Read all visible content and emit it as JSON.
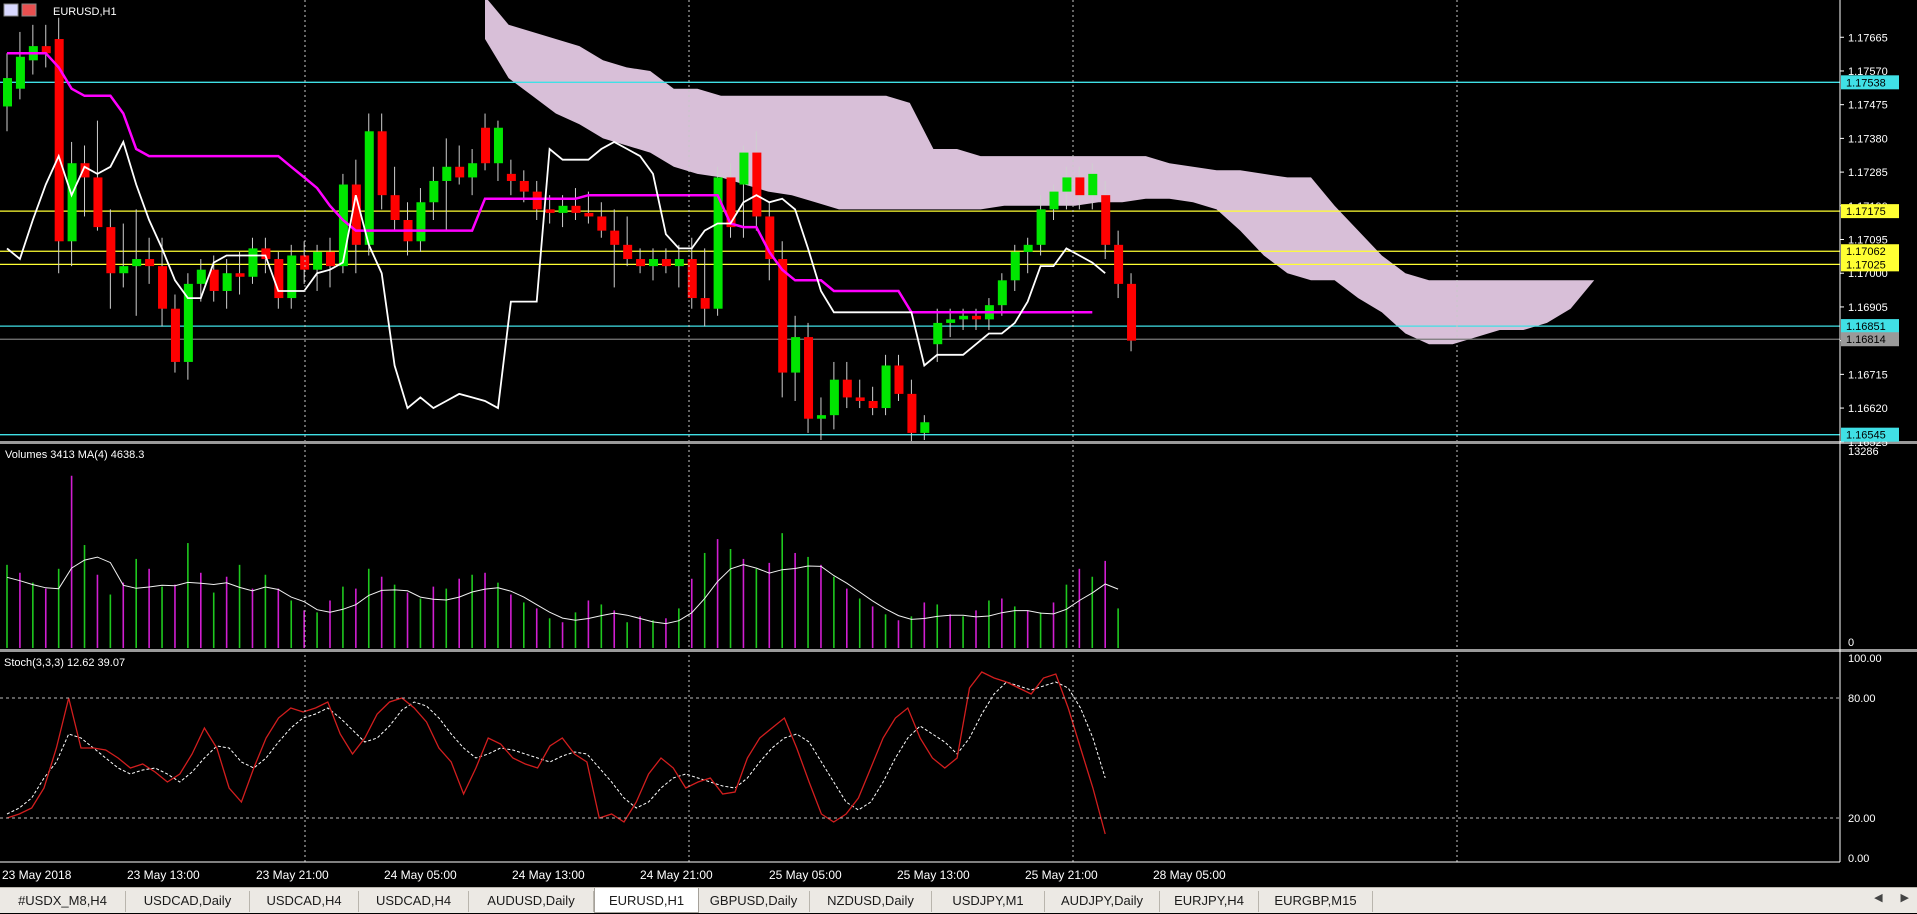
{
  "window": {
    "symbol_label": "EURUSD,H1"
  },
  "colors": {
    "background": "#000000",
    "grid": "#c8c8c8",
    "axis_text": "#ffffff",
    "bull": "#00e600",
    "bear": "#ff0000",
    "cloud": "#d8bfd8",
    "tenkan": "#ff00ff",
    "kijun": "#ffffff",
    "cyan_line": "#40e0e6",
    "yellow_line": "#ffff33",
    "volume_up": "#1ec81e",
    "volume_down": "#d21ed2",
    "stoch_main": "#d21e1e",
    "stoch_signal": "#ffffff"
  },
  "chart_data": [
    {
      "type": "candlestick",
      "title": "EURUSD,H1",
      "price_axis_ticks": [
        "1.17665",
        "1.17570",
        "1.17475",
        "1.17380",
        "1.17285",
        "1.17190",
        "1.17095",
        "1.17000",
        "1.16905",
        "1.16810",
        "1.16715",
        "1.16620",
        "1.16525"
      ],
      "ylim": [
        1.1653,
        1.1777
      ],
      "horizontal_levels": [
        {
          "label": "1.17538",
          "value": 1.17538,
          "color": "cyan"
        },
        {
          "label": "1.17175",
          "value": 1.17175,
          "color": "yellow"
        },
        {
          "label": "1.17062",
          "value": 1.17062,
          "color": "yellow"
        },
        {
          "label": "1.17025",
          "value": 1.17025,
          "color": "yellow"
        },
        {
          "label": "1.16851",
          "value": 1.16851,
          "color": "cyan"
        },
        {
          "label": "1.16814",
          "value": 1.16814,
          "color": "gray"
        },
        {
          "label": "1.16545",
          "value": 1.16545,
          "color": "cyan"
        }
      ],
      "time_labels": [
        "23 May 2018",
        "23 May 13:00",
        "23 May 21:00",
        "24 May 05:00",
        "24 May 13:00",
        "24 May 21:00",
        "25 May 05:00",
        "25 May 13:00",
        "25 May 21:00",
        "28 May 05:00"
      ],
      "candles": [
        {
          "o": 1.1747,
          "h": 1.1762,
          "l": 1.174,
          "c": 1.1755
        },
        {
          "o": 1.1752,
          "h": 1.1768,
          "l": 1.1749,
          "c": 1.1761
        },
        {
          "o": 1.176,
          "h": 1.177,
          "l": 1.1756,
          "c": 1.1764
        },
        {
          "o": 1.1764,
          "h": 1.177,
          "l": 1.1758,
          "c": 1.1762
        },
        {
          "o": 1.1766,
          "h": 1.1772,
          "l": 1.17,
          "c": 1.1709
        },
        {
          "o": 1.1709,
          "h": 1.1737,
          "l": 1.1702,
          "c": 1.1731
        },
        {
          "o": 1.1731,
          "h": 1.1736,
          "l": 1.1716,
          "c": 1.1727
        },
        {
          "o": 1.1727,
          "h": 1.1743,
          "l": 1.1712,
          "c": 1.1713
        },
        {
          "o": 1.1713,
          "h": 1.1718,
          "l": 1.169,
          "c": 1.17
        },
        {
          "o": 1.17,
          "h": 1.1714,
          "l": 1.1696,
          "c": 1.1702
        },
        {
          "o": 1.1702,
          "h": 1.1718,
          "l": 1.1688,
          "c": 1.1704
        },
        {
          "o": 1.1704,
          "h": 1.171,
          "l": 1.1697,
          "c": 1.1702
        },
        {
          "o": 1.1702,
          "h": 1.171,
          "l": 1.1685,
          "c": 1.169
        },
        {
          "o": 1.169,
          "h": 1.1694,
          "l": 1.1672,
          "c": 1.1675
        },
        {
          "o": 1.1675,
          "h": 1.17,
          "l": 1.167,
          "c": 1.1697
        },
        {
          "o": 1.1697,
          "h": 1.1704,
          "l": 1.1692,
          "c": 1.1701
        },
        {
          "o": 1.1701,
          "h": 1.1705,
          "l": 1.1692,
          "c": 1.1695
        },
        {
          "o": 1.1695,
          "h": 1.1704,
          "l": 1.169,
          "c": 1.17
        },
        {
          "o": 1.17,
          "h": 1.1706,
          "l": 1.1694,
          "c": 1.1699
        },
        {
          "o": 1.1699,
          "h": 1.171,
          "l": 1.1697,
          "c": 1.1707
        },
        {
          "o": 1.1707,
          "h": 1.171,
          "l": 1.17,
          "c": 1.1704
        },
        {
          "o": 1.1704,
          "h": 1.1706,
          "l": 1.169,
          "c": 1.1693
        },
        {
          "o": 1.1693,
          "h": 1.1708,
          "l": 1.169,
          "c": 1.1705
        },
        {
          "o": 1.1705,
          "h": 1.1709,
          "l": 1.1697,
          "c": 1.1701
        },
        {
          "o": 1.1701,
          "h": 1.1708,
          "l": 1.1695,
          "c": 1.1706
        },
        {
          "o": 1.1706,
          "h": 1.171,
          "l": 1.1696,
          "c": 1.1702
        },
        {
          "o": 1.1702,
          "h": 1.1728,
          "l": 1.17,
          "c": 1.1725
        },
        {
          "o": 1.1725,
          "h": 1.1732,
          "l": 1.17,
          "c": 1.1708
        },
        {
          "o": 1.1708,
          "h": 1.1745,
          "l": 1.1705,
          "c": 1.174
        },
        {
          "o": 1.174,
          "h": 1.1745,
          "l": 1.1718,
          "c": 1.1722
        },
        {
          "o": 1.1722,
          "h": 1.173,
          "l": 1.1712,
          "c": 1.1715
        },
        {
          "o": 1.1715,
          "h": 1.172,
          "l": 1.1705,
          "c": 1.1709
        },
        {
          "o": 1.1709,
          "h": 1.1724,
          "l": 1.1706,
          "c": 1.172
        },
        {
          "o": 1.172,
          "h": 1.173,
          "l": 1.1715,
          "c": 1.1726
        },
        {
          "o": 1.1726,
          "h": 1.1738,
          "l": 1.1712,
          "c": 1.173
        },
        {
          "o": 1.173,
          "h": 1.1736,
          "l": 1.1725,
          "c": 1.1727
        },
        {
          "o": 1.1727,
          "h": 1.1735,
          "l": 1.1722,
          "c": 1.1731
        },
        {
          "o": 1.1741,
          "h": 1.1745,
          "l": 1.1729,
          "c": 1.1731
        },
        {
          "o": 1.1731,
          "h": 1.1743,
          "l": 1.1726,
          "c": 1.1741
        },
        {
          "o": 1.1728,
          "h": 1.1732,
          "l": 1.1722,
          "c": 1.1726
        },
        {
          "o": 1.1726,
          "h": 1.1729,
          "l": 1.172,
          "c": 1.1723
        },
        {
          "o": 1.1723,
          "h": 1.1726,
          "l": 1.1715,
          "c": 1.1718
        },
        {
          "o": 1.1718,
          "h": 1.1722,
          "l": 1.1714,
          "c": 1.1717
        },
        {
          "o": 1.1717,
          "h": 1.1722,
          "l": 1.1713,
          "c": 1.1719
        },
        {
          "o": 1.1719,
          "h": 1.1724,
          "l": 1.1715,
          "c": 1.1717
        },
        {
          "o": 1.1717,
          "h": 1.1723,
          "l": 1.1714,
          "c": 1.1716
        },
        {
          "o": 1.1716,
          "h": 1.172,
          "l": 1.171,
          "c": 1.1712
        },
        {
          "o": 1.1712,
          "h": 1.1718,
          "l": 1.1696,
          "c": 1.1708
        },
        {
          "o": 1.1708,
          "h": 1.1716,
          "l": 1.1702,
          "c": 1.1704
        },
        {
          "o": 1.1704,
          "h": 1.1707,
          "l": 1.17,
          "c": 1.1702
        },
        {
          "o": 1.1702,
          "h": 1.1707,
          "l": 1.1698,
          "c": 1.1704
        },
        {
          "o": 1.1704,
          "h": 1.1707,
          "l": 1.17,
          "c": 1.1702
        },
        {
          "o": 1.1702,
          "h": 1.1708,
          "l": 1.1696,
          "c": 1.1704
        },
        {
          "o": 1.1704,
          "h": 1.171,
          "l": 1.169,
          "c": 1.1693
        },
        {
          "o": 1.1693,
          "h": 1.1707,
          "l": 1.1685,
          "c": 1.169
        },
        {
          "o": 1.169,
          "h": 1.173,
          "l": 1.1688,
          "c": 1.1727
        },
        {
          "o": 1.1727,
          "h": 1.1731,
          "l": 1.171,
          "c": 1.1713
        },
        {
          "o": 1.1725,
          "h": 1.1736,
          "l": 1.171,
          "c": 1.1734
        },
        {
          "o": 1.1734,
          "h": 1.174,
          "l": 1.1712,
          "c": 1.1716
        },
        {
          "o": 1.1716,
          "h": 1.172,
          "l": 1.1698,
          "c": 1.1704
        },
        {
          "o": 1.1704,
          "h": 1.1709,
          "l": 1.1665,
          "c": 1.1672
        },
        {
          "o": 1.1672,
          "h": 1.1688,
          "l": 1.1664,
          "c": 1.1682
        },
        {
          "o": 1.1682,
          "h": 1.1686,
          "l": 1.1655,
          "c": 1.1659
        },
        {
          "o": 1.1659,
          "h": 1.1665,
          "l": 1.1653,
          "c": 1.166
        },
        {
          "o": 1.166,
          "h": 1.1675,
          "l": 1.1656,
          "c": 1.167
        },
        {
          "o": 1.167,
          "h": 1.1675,
          "l": 1.1662,
          "c": 1.1665
        },
        {
          "o": 1.1665,
          "h": 1.167,
          "l": 1.1662,
          "c": 1.1664
        },
        {
          "o": 1.1664,
          "h": 1.1668,
          "l": 1.166,
          "c": 1.1662
        },
        {
          "o": 1.1662,
          "h": 1.1677,
          "l": 1.166,
          "c": 1.1674
        },
        {
          "o": 1.1674,
          "h": 1.1677,
          "l": 1.1664,
          "c": 1.1666
        },
        {
          "o": 1.1666,
          "h": 1.167,
          "l": 1.1652,
          "c": 1.1655
        },
        {
          "o": 1.1655,
          "h": 1.166,
          "l": 1.1653,
          "c": 1.1658
        },
        {
          "o": 1.168,
          "h": 1.169,
          "l": 1.1675,
          "c": 1.1686
        },
        {
          "o": 1.1686,
          "h": 1.169,
          "l": 1.1682,
          "c": 1.1687
        },
        {
          "o": 1.1687,
          "h": 1.169,
          "l": 1.1684,
          "c": 1.1688
        },
        {
          "o": 1.1688,
          "h": 1.169,
          "l": 1.1684,
          "c": 1.1687
        },
        {
          "o": 1.1687,
          "h": 1.1693,
          "l": 1.1684,
          "c": 1.1691
        },
        {
          "o": 1.1691,
          "h": 1.17,
          "l": 1.1688,
          "c": 1.1698
        },
        {
          "o": 1.1698,
          "h": 1.1708,
          "l": 1.1695,
          "c": 1.1706
        },
        {
          "o": 1.1706,
          "h": 1.171,
          "l": 1.17,
          "c": 1.1708
        },
        {
          "o": 1.1708,
          "h": 1.1722,
          "l": 1.1705,
          "c": 1.1718
        },
        {
          "o": 1.1718,
          "h": 1.1725,
          "l": 1.1715,
          "c": 1.1723
        },
        {
          "o": 1.1723,
          "h": 1.173,
          "l": 1.1718,
          "c": 1.1727
        },
        {
          "o": 1.1727,
          "h": 1.173,
          "l": 1.1718,
          "c": 1.1722
        },
        {
          "o": 1.1722,
          "h": 1.1731,
          "l": 1.1718,
          "c": 1.1728
        },
        {
          "o": 1.1722,
          "h": 1.1726,
          "l": 1.1704,
          "c": 1.1708
        },
        {
          "o": 1.1708,
          "h": 1.1712,
          "l": 1.1693,
          "c": 1.1697
        },
        {
          "o": 1.1697,
          "h": 1.17,
          "l": 1.1678,
          "c": 1.1681
        }
      ],
      "tenkan_line": [
        1.1762,
        1.1762,
        1.1762,
        1.1762,
        1.1758,
        1.1752,
        1.175,
        1.175,
        1.175,
        1.1745,
        1.1735,
        1.1733,
        1.1733,
        1.1733,
        1.1733,
        1.1733,
        1.1733,
        1.1733,
        1.1733,
        1.1733,
        1.1733,
        1.1733,
        1.173,
        1.1727,
        1.1724,
        1.1719,
        1.1715,
        1.1712,
        1.1712,
        1.1712,
        1.1712,
        1.1712,
        1.1712,
        1.1712,
        1.1712,
        1.1712,
        1.1712,
        1.1721,
        1.1721,
        1.1721,
        1.1721,
        1.1721,
        1.1721,
        1.1721,
        1.1721,
        1.1722,
        1.1722,
        1.1722,
        1.1722,
        1.1722,
        1.1722,
        1.1722,
        1.1722,
        1.1722,
        1.1722,
        1.1722,
        1.1714,
        1.1713,
        1.1713,
        1.1706,
        1.1701,
        1.1698,
        1.1698,
        1.1698,
        1.1695,
        1.1695,
        1.1695,
        1.1695,
        1.1695,
        1.1695,
        1.1689,
        1.1689,
        1.1689,
        1.1689,
        1.1689,
        1.1689,
        1.1689,
        1.1689,
        1.1689,
        1.1689,
        1.1689,
        1.1689,
        1.1689,
        1.1689,
        1.1689
      ],
      "kijun_line": [
        1.1707,
        1.1704,
        1.1715,
        1.1725,
        1.1733,
        1.1722,
        1.173,
        1.1728,
        1.173,
        1.1737,
        1.1725,
        1.1715,
        1.1707,
        1.1698,
        1.1693,
        1.1693,
        1.1703,
        1.1705,
        1.1705,
        1.1705,
        1.1705,
        1.1695,
        1.1695,
        1.1695,
        1.17,
        1.1701,
        1.1703,
        1.1722,
        1.1708,
        1.17,
        1.1674,
        1.1662,
        1.1665,
        1.1662,
        1.1664,
        1.1666,
        1.1665,
        1.1664,
        1.1662,
        1.1692,
        1.1692,
        1.1692,
        1.1735,
        1.1732,
        1.1732,
        1.1732,
        1.1735,
        1.1737,
        1.1735,
        1.1733,
        1.1728,
        1.1711,
        1.1707,
        1.1707,
        1.1712,
        1.1714,
        1.1714,
        1.172,
        1.1722,
        1.172,
        1.1721,
        1.1718,
        1.1707,
        1.1695,
        1.1689,
        1.1689,
        1.1689,
        1.1689,
        1.1689,
        1.1689,
        1.1689,
        1.1674,
        1.1677,
        1.1677,
        1.1677,
        1.168,
        1.1683,
        1.1683,
        1.1686,
        1.1692,
        1.1702,
        1.1702,
        1.1707,
        1.1705,
        1.1703,
        1.17
      ],
      "cloud_top": [
        1.1778,
        1.177,
        1.1768,
        1.1766,
        1.1764,
        1.176,
        1.1758,
        1.1757,
        1.1752,
        1.1752,
        1.175,
        1.175,
        1.175,
        1.175,
        1.175,
        1.175,
        1.175,
        1.175,
        1.1748,
        1.1735,
        1.1735,
        1.1733,
        1.1733,
        1.1733,
        1.1733,
        1.1733,
        1.1733,
        1.1733,
        1.1733,
        1.1731,
        1.173,
        1.1729,
        1.1729,
        1.1728,
        1.1727,
        1.1727,
        1.1719,
        1.1712,
        1.1705,
        1.17,
        1.1698,
        1.1698,
        1.1698,
        1.1698,
        1.1698,
        1.1698,
        1.1698,
        1.1698,
        1.1698,
        1.1698,
        1.1697
      ],
      "cloud_bottom": [
        1.1766,
        1.1755,
        1.175,
        1.1745,
        1.1742,
        1.1738,
        1.1736,
        1.1734,
        1.173,
        1.1728,
        1.1727,
        1.1725,
        1.1723,
        1.1722,
        1.172,
        1.1718,
        1.1718,
        1.1718,
        1.1718,
        1.1718,
        1.1718,
        1.1718,
        1.1719,
        1.1719,
        1.1719,
        1.1719,
        1.172,
        1.172,
        1.1721,
        1.1721,
        1.172,
        1.1718,
        1.1712,
        1.1705,
        1.17,
        1.1698,
        1.1698,
        1.1693,
        1.1689,
        1.1683,
        1.168,
        1.168,
        1.1682,
        1.1684,
        1.1684,
        1.1686,
        1.169,
        1.1698,
        1.1698,
        1.1698,
        1.1697
      ]
    },
    {
      "type": "bar",
      "title": "Volumes 3413 MA(4) 4638.3",
      "axis_labels": [
        "13286",
        "0"
      ],
      "ylim": [
        0,
        13286
      ]
    },
    {
      "type": "line",
      "title": "Stoch(3,3,3) 12.62 39.07",
      "axis_labels": [
        "100.00",
        "80.00",
        "20.00",
        "0.00"
      ],
      "ylim": [
        0,
        100
      ],
      "levels": [
        80,
        20
      ]
    }
  ],
  "tabs": [
    {
      "label": "#USDX_M8,H4",
      "active": false
    },
    {
      "label": "USDCAD,Daily",
      "active": false
    },
    {
      "label": "USDCAD,H4",
      "active": false
    },
    {
      "label": "USDCAD,H4",
      "active": false
    },
    {
      "label": "AUDUSD,Daily",
      "active": false
    },
    {
      "label": "EURUSD,H1",
      "active": true
    },
    {
      "label": "GBPUSD,Daily",
      "active": false
    },
    {
      "label": "NZDUSD,Daily",
      "active": false
    },
    {
      "label": "USDJPY,M1",
      "active": false
    },
    {
      "label": "AUDJPY,Daily",
      "active": false
    },
    {
      "label": "EURJPY,H4",
      "active": false
    },
    {
      "label": "EURGBP,M15",
      "active": false
    }
  ],
  "icons": {
    "scroll_left": "triangle-left-icon",
    "scroll_right": "triangle-right-icon"
  }
}
